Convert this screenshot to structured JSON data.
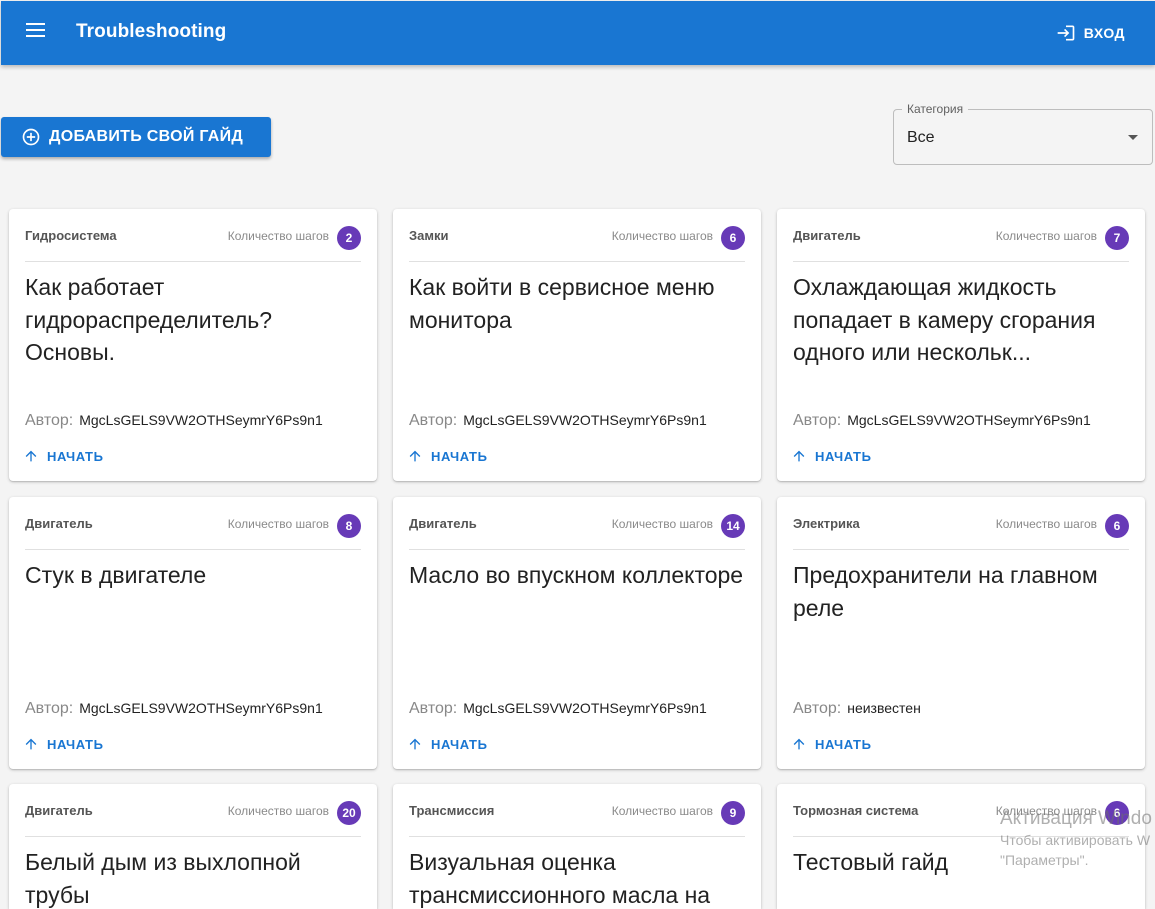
{
  "appbar": {
    "title": "Troubleshooting",
    "login_label": "ВХОД",
    "menu_icon": "hamburger-menu-icon",
    "login_icon": "login-icon",
    "color": "#1976d2"
  },
  "toolbar": {
    "add_label": "ДОБАВИТЬ СВОЙ ГАЙД",
    "add_icon": "add-circle-icon"
  },
  "category": {
    "label": "Категория",
    "value": "Все"
  },
  "steps_label": "Количество шагов",
  "author_label": "Автор:",
  "start_label": "НАЧАТЬ",
  "badge_color": "#673ab7",
  "cards": [
    {
      "category": "Гидросистема",
      "steps": "2",
      "title": "Как работает гидрораспределитель? Основы.",
      "author": "MgcLsGELS9VW2OTHSeymrY6Ps9n1"
    },
    {
      "category": "Замки",
      "steps": "6",
      "title": "Как войти в сервисное меню монитора",
      "author": "MgcLsGELS9VW2OTHSeymrY6Ps9n1"
    },
    {
      "category": "Двигатель",
      "steps": "7",
      "title": "Охлаждающая жидкость попадает в камеру сгорания одного или нескольк...",
      "author": "MgcLsGELS9VW2OTHSeymrY6Ps9n1"
    },
    {
      "category": "Двигатель",
      "steps": "8",
      "title": "Стук в двигателе",
      "author": "MgcLsGELS9VW2OTHSeymrY6Ps9n1"
    },
    {
      "category": "Двигатель",
      "steps": "14",
      "title": "Масло во впускном коллекторе",
      "author": "MgcLsGELS9VW2OTHSeymrY6Ps9n1"
    },
    {
      "category": "Электрика",
      "steps": "6",
      "title": "Предохранители на главном реле",
      "author": "неизвестен"
    },
    {
      "category": "Двигатель",
      "steps": "20",
      "title": "Белый дым из выхлопной трубы"
    },
    {
      "category": "Трансмиссия",
      "steps": "9",
      "title": "Визуальная оценка трансмиссионного масла на"
    },
    {
      "category": "Тормозная система",
      "steps": "6",
      "title": "Тестовый гайд"
    }
  ],
  "watermark": {
    "title": "Активация Windo",
    "line1": "Чтобы активировать W",
    "line2": "\"Параметры\"."
  }
}
